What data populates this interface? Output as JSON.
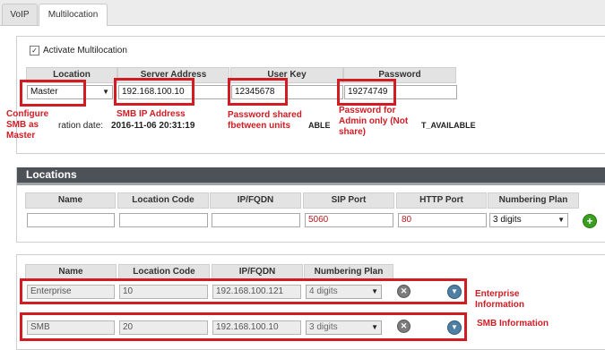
{
  "tabs": [
    "VoIP",
    "Multilocation"
  ],
  "activate": {
    "label": "Activate Multilocation",
    "checked": true
  },
  "top_table": {
    "headers": [
      "Location",
      "Server Address",
      "User Key",
      "Password"
    ],
    "location_value": "Master",
    "server_address": "192.168.100.10",
    "user_key": "12345678",
    "password": "19274749"
  },
  "status": {
    "expiration_label": "ration date:",
    "expiration_value": "2016-11-06 20:31:19",
    "available_a": "ABLE",
    "available_b": "T_AVAILABLE"
  },
  "annotations": {
    "configure": "Configure SMB as Master",
    "smb_ip": "SMB IP Address",
    "password_shared": "Password shared fbetween units",
    "password_admin": "Password for Admin only (Not share)",
    "enterprise_info": "Enterprise Information",
    "smb_info": "SMB Information"
  },
  "locations": {
    "title": "Locations",
    "headers": [
      "Name",
      "Location Code",
      "IP/FQDN",
      "SIP Port",
      "HTTP Port",
      "Numbering Plan"
    ],
    "new_row": {
      "name": "",
      "code": "",
      "ip": "",
      "sip_port": "5060",
      "http_port": "80",
      "plan": "3 digits"
    },
    "list_headers": [
      "Name",
      "Location Code",
      "IP/FQDN",
      "Numbering Plan"
    ],
    "rows": [
      {
        "name": "Enterprise",
        "code": "10",
        "ip": "192.168.100.121",
        "plan": "4 digits"
      },
      {
        "name": "SMB",
        "code": "20",
        "ip": "192.168.100.10",
        "plan": "3 digits"
      }
    ]
  },
  "icons": {
    "add": "plus-icon",
    "delete": "close-icon",
    "expand": "chevron-down-icon"
  },
  "colors": {
    "annotation": "#d21c24",
    "add_green": "#3a9e1f",
    "expand_blue": "#4f7fa3"
  }
}
